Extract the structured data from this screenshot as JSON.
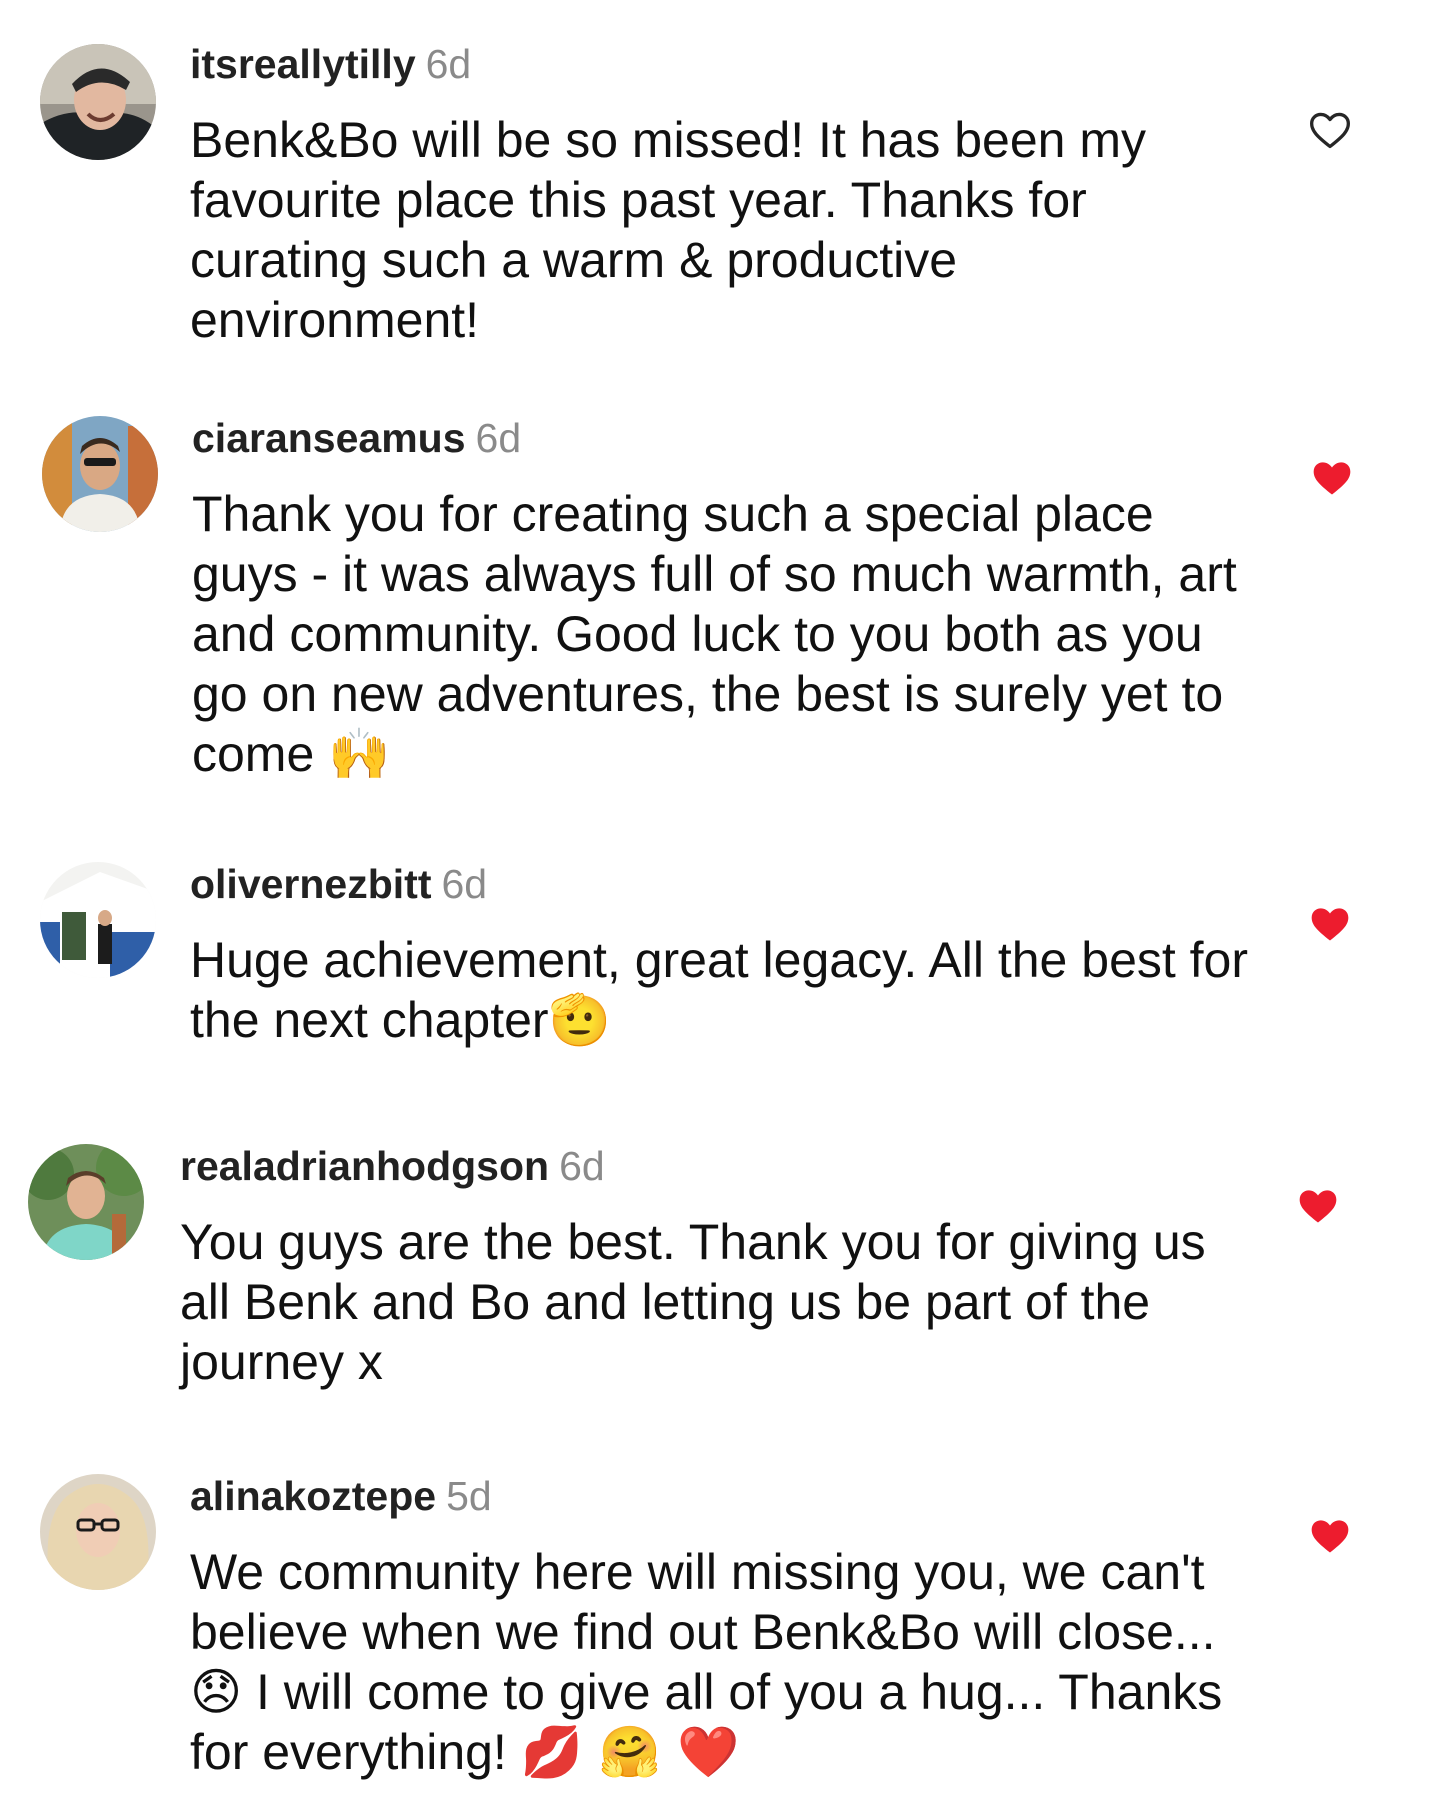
{
  "colors": {
    "liked": "#ed1c2e",
    "unliked_outline": "#262626",
    "timestamp": "#8a8a8a"
  },
  "comments": [
    {
      "username": "itsreallytilly",
      "time": "6d",
      "text": "Benk&Bo will be so missed! It has been my favourite place this past year. Thanks for curating such a warm & productive environment!",
      "emojis": "",
      "liked": false,
      "like_icon": "heart-outline-icon"
    },
    {
      "username": "ciaranseamus",
      "time": "6d",
      "text": "Thank you for creating such a special place guys - it was always full of so much warmth, art and community. Good luck to you both as you go on new adventures, the best is surely yet to come",
      "emojis": "🙌",
      "liked": true,
      "like_icon": "heart-filled-icon"
    },
    {
      "username": "olivernezbitt",
      "time": "6d",
      "text": "Huge achievement, great legacy. All the best for the next chapter",
      "emojis": "🫡",
      "liked": true,
      "like_icon": "heart-filled-icon"
    },
    {
      "username": "realadrianhodgson",
      "time": "6d",
      "text": "You guys are the best. Thank you for giving us all Benk and Bo and letting us be part of the journey x",
      "emojis": "",
      "liked": true,
      "like_icon": "heart-filled-icon"
    },
    {
      "username": "alinakoztepe",
      "time": "5d",
      "text": "We community here will missing you, we can't believe when we find out Benk&Bo will close... 😞 I will come to give all of you a hug... Thanks for everything!",
      "emojis": "💋 🤗 ❤️",
      "liked": true,
      "like_icon": "heart-filled-icon"
    }
  ]
}
